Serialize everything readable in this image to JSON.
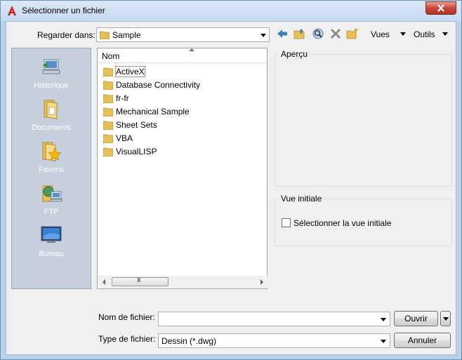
{
  "window": {
    "title": "Sélectionner un fichier"
  },
  "toolbar": {
    "look_in_label": "Regarder dans:",
    "look_in_value": "Sample",
    "views_label": "Vues",
    "tools_label": "Outils"
  },
  "places": [
    {
      "label": "Historique"
    },
    {
      "label": "Documents"
    },
    {
      "label": "Favoris"
    },
    {
      "label": "FTP"
    },
    {
      "label": "Bureau"
    }
  ],
  "file_list": {
    "column_name": "Nom",
    "items": [
      {
        "name": "ActiveX"
      },
      {
        "name": "Database Connectivity"
      },
      {
        "name": "fr-fr"
      },
      {
        "name": "Mechanical Sample"
      },
      {
        "name": "Sheet Sets"
      },
      {
        "name": "VBA"
      },
      {
        "name": "VisualLISP"
      }
    ],
    "scroll_thumb_glyph": "III"
  },
  "preview": {
    "title": "Aperçu"
  },
  "initial_view": {
    "title": "Vue initiale",
    "checkbox_label": "Sélectionner la vue initiale",
    "checked": false
  },
  "filename": {
    "label": "Nom de fichier:",
    "value": ""
  },
  "filetype": {
    "label": "Type de fichier:",
    "value": "Dessin (*.dwg)"
  },
  "buttons": {
    "open": "Ouvrir",
    "cancel": "Annuler"
  },
  "colors": {
    "places_bg": "#c5d0dc",
    "folder": "#e8c05a",
    "accent": "#3c7fb1",
    "title_icon": "#d01e1e"
  }
}
